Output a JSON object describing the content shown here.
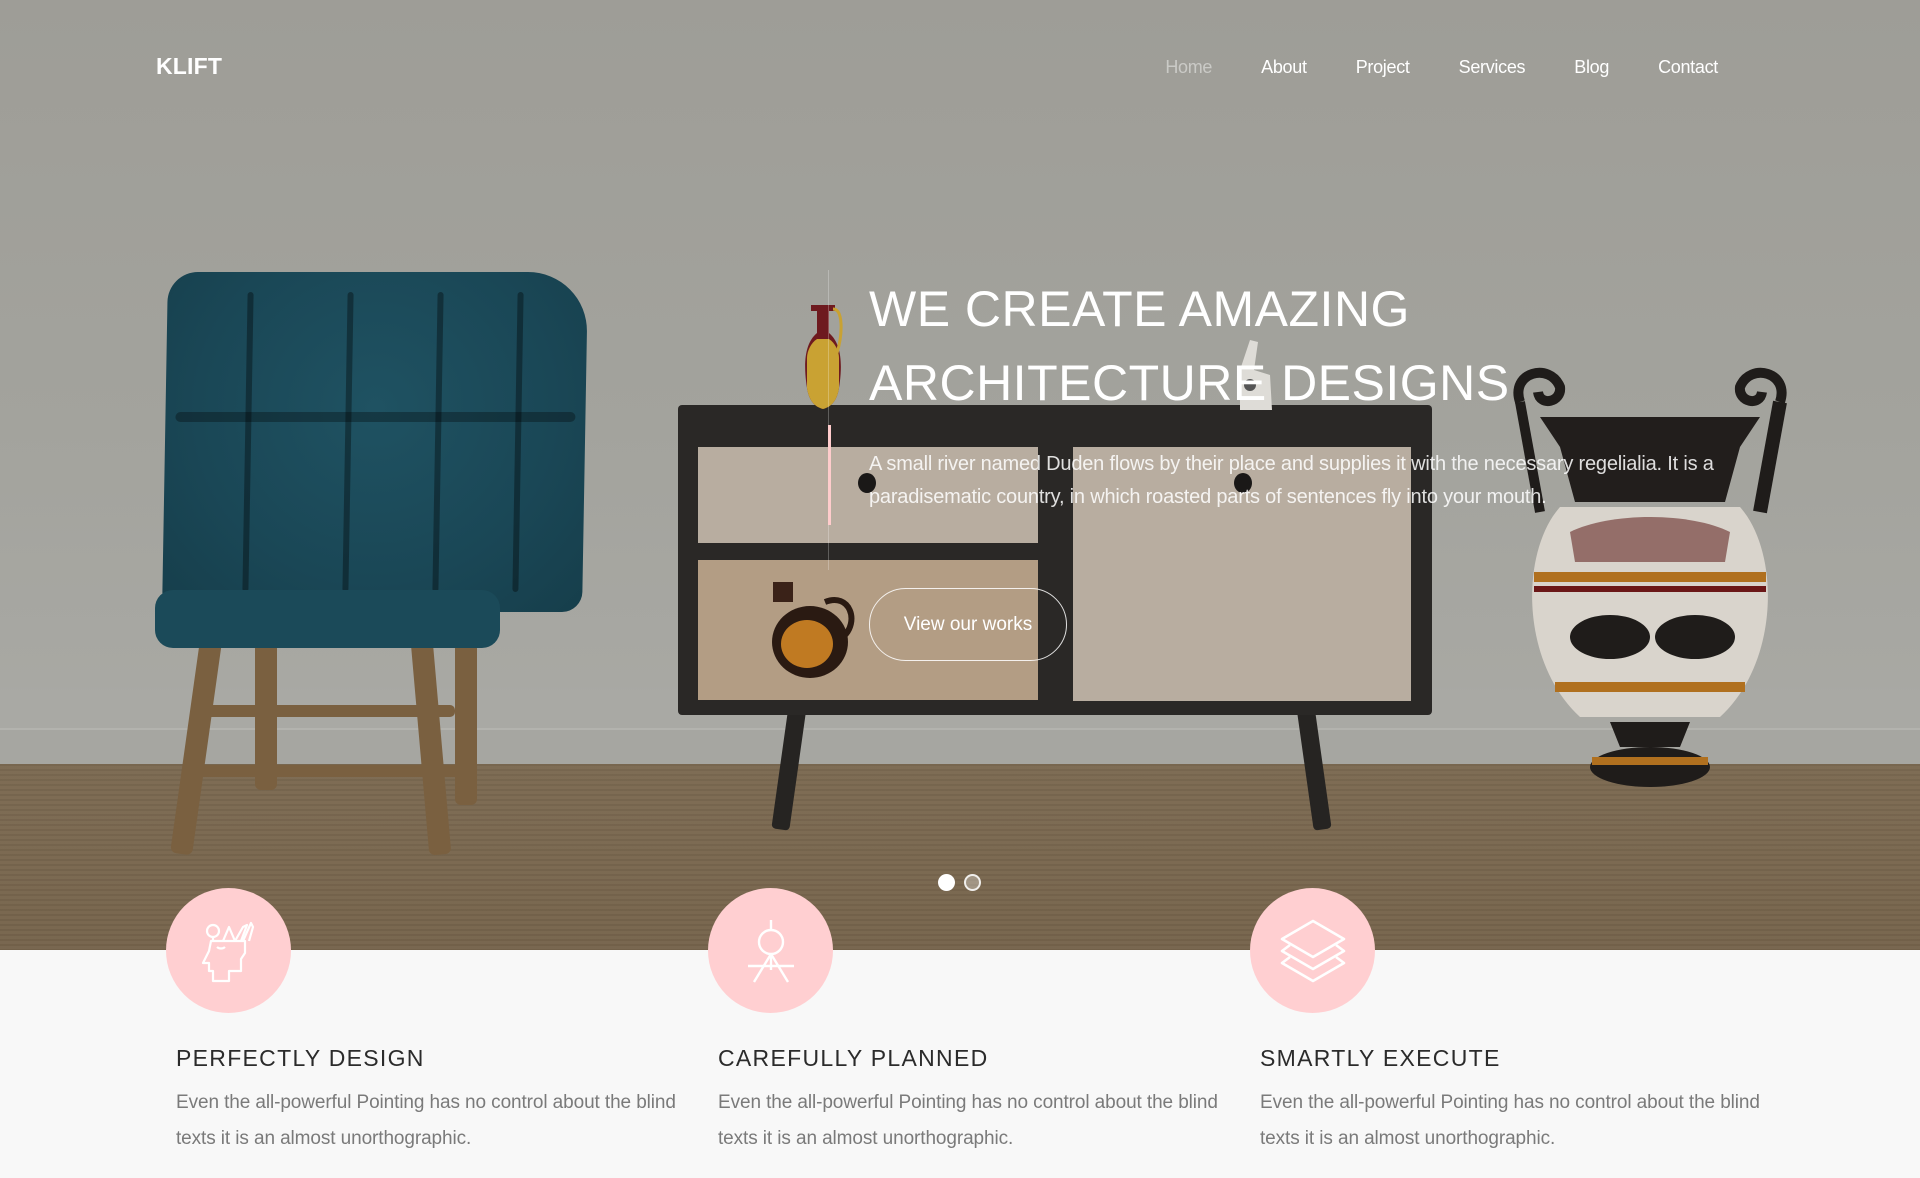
{
  "nav": {
    "logo": "KLIFT",
    "items": [
      {
        "label": "Home",
        "active": true
      },
      {
        "label": "About",
        "active": false
      },
      {
        "label": "Project",
        "active": false
      },
      {
        "label": "Services",
        "active": false
      },
      {
        "label": "Blog",
        "active": false
      },
      {
        "label": "Contact",
        "active": false
      }
    ]
  },
  "hero": {
    "title_line1": "WE CREATE AMAZING",
    "title_line2": "ARCHITECTURE DESIGNS",
    "text": "A small river named Duden flows by their place and supplies it with the necessary regelialia. It is a paradisematic country, in which roasted parts of sentences fly into your mouth.",
    "button_label": "View our works",
    "slides": {
      "count": 2,
      "active_index": 0
    }
  },
  "features": [
    {
      "icon": "head-ideas-icon",
      "title": "PERFECTLY DESIGN",
      "text": "Even the all-powerful Pointing has no control about the blind texts it is an almost unorthographic."
    },
    {
      "icon": "compass-icon",
      "title": "CAREFULLY PLANNED",
      "text": "Even the all-powerful Pointing has no control about the blind texts it is an almost unorthographic."
    },
    {
      "icon": "layers-icon",
      "title": "SMARTLY EXECUTE",
      "text": "Even the all-powerful Pointing has no control about the blind texts it is an almost unorthographic."
    }
  ],
  "colors": {
    "accent": "#ffcfd1",
    "heading": "#2b2b2b",
    "body_text": "#7a7a7a",
    "page_bg": "#f8f8f8"
  }
}
